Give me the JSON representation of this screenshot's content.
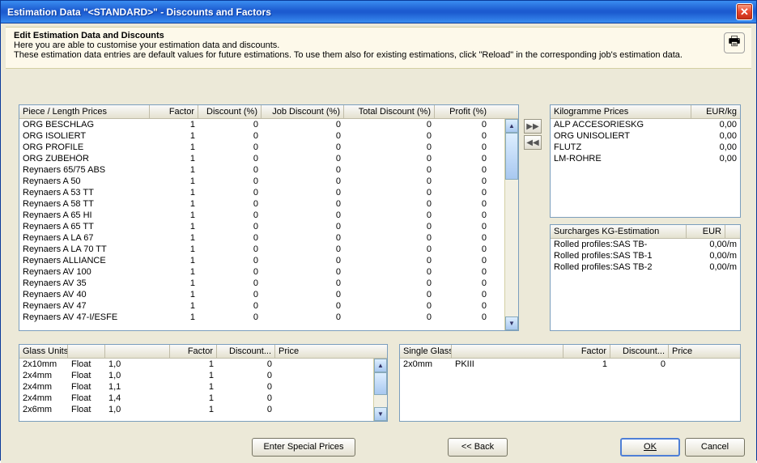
{
  "window": {
    "title": "Estimation Data \"<STANDARD>\" - Discounts and Factors"
  },
  "info": {
    "heading": "Edit Estimation Data and Discounts",
    "line1": "Here you are able to customise your estimation data and discounts.",
    "line2": "These estimation data entries are default values for future estimations. To use them also for existing estimations, click \"Reload\" in the corresponding job's estimation data."
  },
  "buttons": {
    "special": "Enter Special Prices",
    "back": "<<  Back",
    "ok": "OK",
    "cancel": "Cancel"
  },
  "pieceTable": {
    "headers": [
      "Piece / Length Prices",
      "Factor",
      "Discount (%)",
      "Job Discount (%)",
      "Total Discount (%)",
      "Profit (%)"
    ],
    "rows": [
      {
        "name": "ORG BESCHLAG",
        "factor": "1",
        "disc": "0",
        "jdisc": "0",
        "tdisc": "0",
        "profit": "0"
      },
      {
        "name": "ORG ISOLIERT",
        "factor": "1",
        "disc": "0",
        "jdisc": "0",
        "tdisc": "0",
        "profit": "0"
      },
      {
        "name": "ORG PROFILE",
        "factor": "1",
        "disc": "0",
        "jdisc": "0",
        "tdisc": "0",
        "profit": "0"
      },
      {
        "name": "ORG ZUBEHÖR",
        "factor": "1",
        "disc": "0",
        "jdisc": "0",
        "tdisc": "0",
        "profit": "0"
      },
      {
        "name": "Reynaers 65/75 ABS",
        "factor": "1",
        "disc": "0",
        "jdisc": "0",
        "tdisc": "0",
        "profit": "0"
      },
      {
        "name": "Reynaers A 50",
        "factor": "1",
        "disc": "0",
        "jdisc": "0",
        "tdisc": "0",
        "profit": "0"
      },
      {
        "name": "Reynaers A 53 TT",
        "factor": "1",
        "disc": "0",
        "jdisc": "0",
        "tdisc": "0",
        "profit": "0"
      },
      {
        "name": "Reynaers A 58 TT",
        "factor": "1",
        "disc": "0",
        "jdisc": "0",
        "tdisc": "0",
        "profit": "0"
      },
      {
        "name": "Reynaers A 65 HI",
        "factor": "1",
        "disc": "0",
        "jdisc": "0",
        "tdisc": "0",
        "profit": "0"
      },
      {
        "name": "Reynaers A 65 TT",
        "factor": "1",
        "disc": "0",
        "jdisc": "0",
        "tdisc": "0",
        "profit": "0"
      },
      {
        "name": "Reynaers A LA 67",
        "factor": "1",
        "disc": "0",
        "jdisc": "0",
        "tdisc": "0",
        "profit": "0"
      },
      {
        "name": "Reynaers A LA 70 TT",
        "factor": "1",
        "disc": "0",
        "jdisc": "0",
        "tdisc": "0",
        "profit": "0"
      },
      {
        "name": "Reynaers ALLIANCE",
        "factor": "1",
        "disc": "0",
        "jdisc": "0",
        "tdisc": "0",
        "profit": "0"
      },
      {
        "name": "Reynaers AV 100",
        "factor": "1",
        "disc": "0",
        "jdisc": "0",
        "tdisc": "0",
        "profit": "0"
      },
      {
        "name": "Reynaers AV 35",
        "factor": "1",
        "disc": "0",
        "jdisc": "0",
        "tdisc": "0",
        "profit": "0"
      },
      {
        "name": "Reynaers AV 40",
        "factor": "1",
        "disc": "0",
        "jdisc": "0",
        "tdisc": "0",
        "profit": "0"
      },
      {
        "name": "Reynaers AV 47",
        "factor": "1",
        "disc": "0",
        "jdisc": "0",
        "tdisc": "0",
        "profit": "0"
      },
      {
        "name": "Reynaers AV 47-I/ESFE",
        "factor": "1",
        "disc": "0",
        "jdisc": "0",
        "tdisc": "0",
        "profit": "0"
      }
    ]
  },
  "kgTable": {
    "headers": [
      "Kilogramme Prices",
      "EUR/kg"
    ],
    "rows": [
      {
        "name": "ALP ACCESORIESKG",
        "val": "0,00"
      },
      {
        "name": "ORG UNISOLIERT",
        "val": "0,00"
      },
      {
        "name": "FLUTZ",
        "val": "0,00"
      },
      {
        "name": "LM-ROHRE",
        "val": "0,00"
      }
    ]
  },
  "surTable": {
    "headers": [
      "Surcharges KG-Estimation",
      "EUR",
      ""
    ],
    "rows": [
      {
        "name": "Rolled profiles:SAS TB-",
        "val": "0,00/m"
      },
      {
        "name": "Rolled profiles:SAS TB-1",
        "val": "0,00/m"
      },
      {
        "name": "Rolled profiles:SAS TB-2",
        "val": "0,00/m"
      }
    ]
  },
  "glassUnits": {
    "headers": [
      "Glass Units",
      "",
      "",
      "Factor",
      "Discount...",
      "Price"
    ],
    "rows": [
      {
        "a": "2x10mm",
        "b": "Float",
        "c": "1,0",
        "factor": "1",
        "disc": "0",
        "price": ""
      },
      {
        "a": "2x4mm",
        "b": "Float",
        "c": "1,0",
        "factor": "1",
        "disc": "0",
        "price": ""
      },
      {
        "a": "2x4mm",
        "b": "Float",
        "c": "1,1",
        "factor": "1",
        "disc": "0",
        "price": ""
      },
      {
        "a": "2x4mm",
        "b": "Float",
        "c": "1,4",
        "factor": "1",
        "disc": "0",
        "price": ""
      },
      {
        "a": "2x6mm",
        "b": "Float",
        "c": "1,0",
        "factor": "1",
        "disc": "0",
        "price": ""
      }
    ]
  },
  "singleGlass": {
    "headers": [
      "Single Glass",
      "",
      "Factor",
      "Discount...",
      "Price"
    ],
    "rows": [
      {
        "a": "2x0mm",
        "b": "PKIII",
        "factor": "1",
        "disc": "0",
        "price": ""
      }
    ]
  }
}
